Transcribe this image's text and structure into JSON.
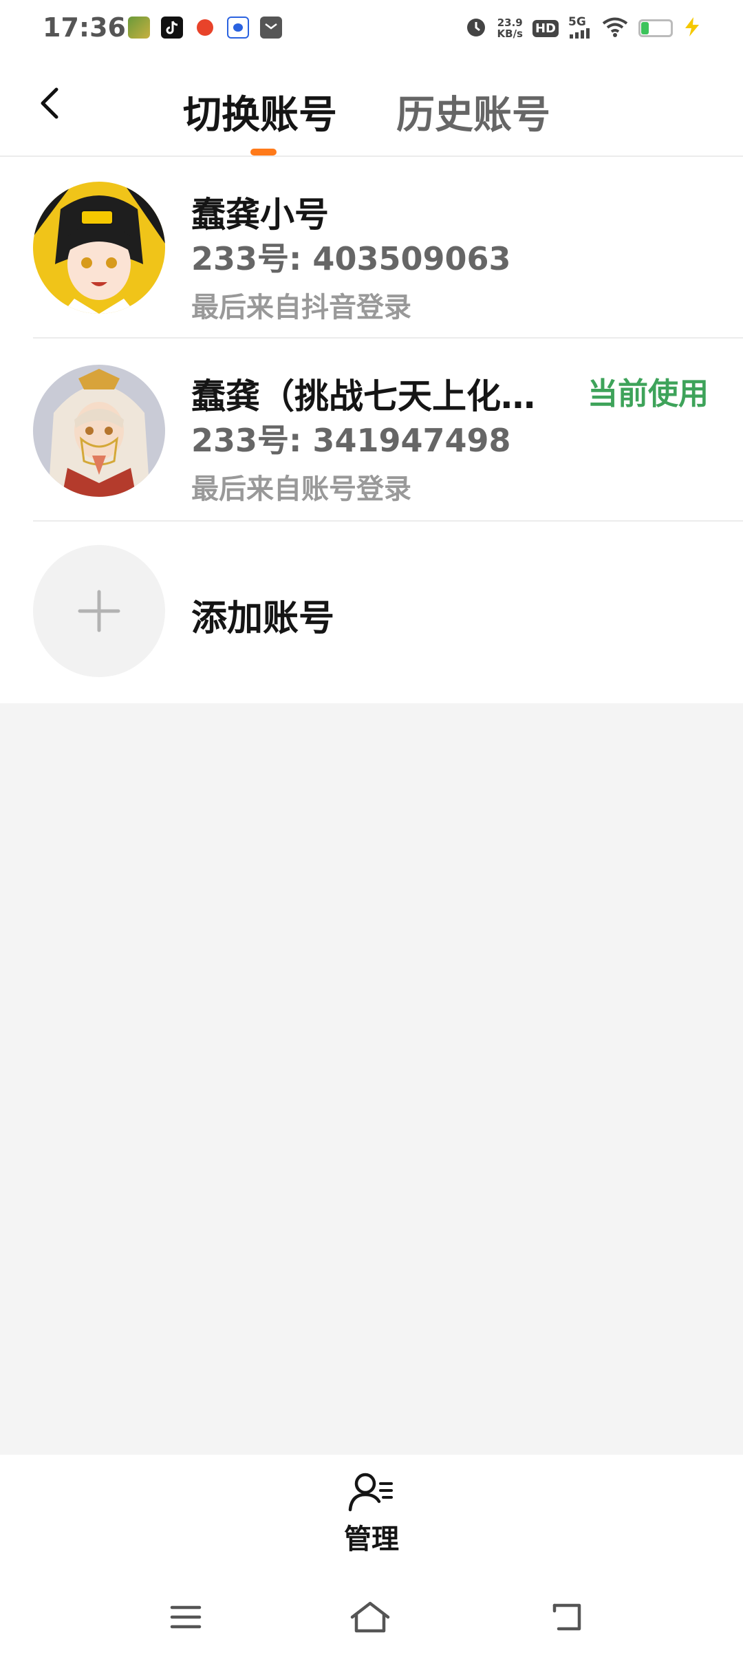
{
  "status_bar": {
    "time": "17:36",
    "net_speed_value": "23.9",
    "net_speed_unit": "KB/s",
    "hd_label": "HD",
    "network_label": "5G",
    "battery_level": 0.25,
    "notification_icons": [
      "game-app-icon",
      "tiktok-icon",
      "weibo-icon",
      "baidu-icon",
      "mail-icon"
    ],
    "colors": {
      "battery_fill": "#3cc35b",
      "charging": "#f5c800"
    }
  },
  "header": {
    "back_icon": "chevron-left-icon",
    "tabs": [
      {
        "label": "切换账号",
        "active": true
      },
      {
        "label": "历史账号",
        "active": false
      }
    ],
    "accent_color": "#ff7a1a"
  },
  "accounts": [
    {
      "name": "蠢龚小号",
      "uid": "233号: 403509063",
      "last_login": "最后来自抖音登录",
      "current": false
    },
    {
      "name": "蠢龚（挑战七天上化…",
      "uid": "233号: 341947498",
      "last_login": "最后来自账号登录",
      "current": true,
      "current_label": "当前使用",
      "current_color": "#3ea35a"
    }
  ],
  "add_account": {
    "label": "添加账号",
    "icon": "plus-icon"
  },
  "bottom": {
    "manage_label": "管理",
    "manage_icon": "user-list-icon"
  },
  "nav_bar": {
    "buttons": [
      "menu-icon",
      "home-icon",
      "back-icon"
    ]
  }
}
